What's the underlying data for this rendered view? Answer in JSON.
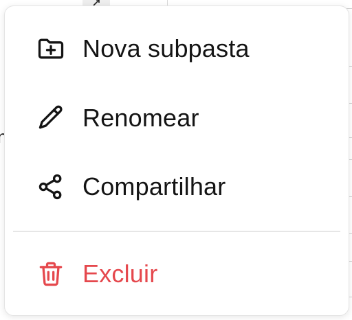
{
  "menu": {
    "items": [
      {
        "label": "Nova subpasta",
        "icon": "folder-plus-icon"
      },
      {
        "label": "Renomear",
        "icon": "pencil-icon"
      },
      {
        "label": "Compartilhar",
        "icon": "share-icon"
      }
    ],
    "danger_item": {
      "label": "Excluir",
      "icon": "trash-icon"
    }
  },
  "colors": {
    "text": "#141414",
    "danger": "#e5484d",
    "divider": "#e6e6e6",
    "border": "#e4e4e4"
  }
}
